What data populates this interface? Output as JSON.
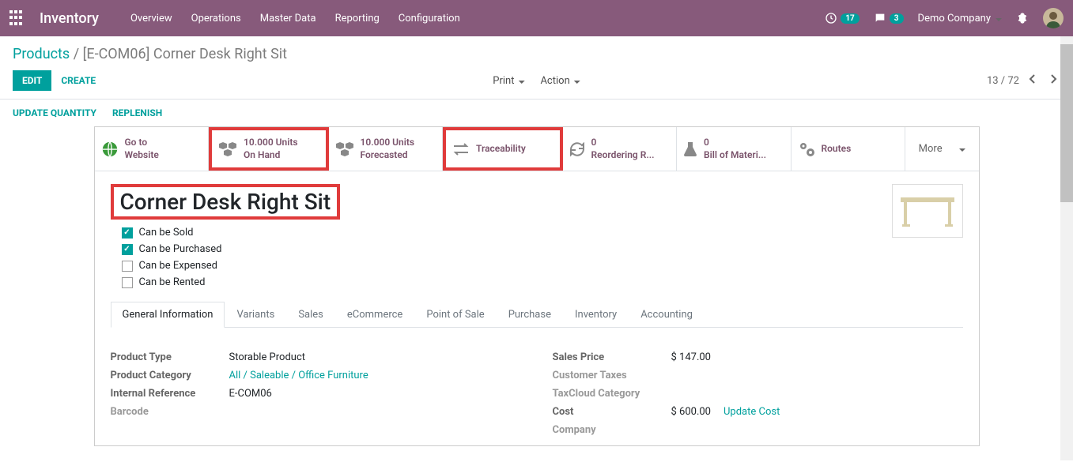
{
  "topbar": {
    "app_name": "Inventory",
    "nav": [
      "Overview",
      "Operations",
      "Master Data",
      "Reporting",
      "Configuration"
    ],
    "clock_badge": "17",
    "chat_badge": "3",
    "company": "Demo Company"
  },
  "breadcrumb": {
    "root": "Products",
    "current": "[E-COM06] Corner Desk Right Sit"
  },
  "buttons": {
    "edit": "EDIT",
    "create": "CREATE",
    "print": "Print",
    "action": "Action"
  },
  "pager": {
    "pos": "13 / 72"
  },
  "secondary": {
    "update_qty": "UPDATE QUANTITY",
    "replenish": "REPLENISH"
  },
  "stats": {
    "go_website": {
      "l1": "Go to",
      "l2": "Website"
    },
    "on_hand": {
      "l1": "10.000 Units",
      "l2": "On Hand"
    },
    "forecast": {
      "l1": "10.000 Units",
      "l2": "Forecasted"
    },
    "trace": {
      "l1": "Traceability"
    },
    "reorder": {
      "l1": "0",
      "l2": "Reordering R..."
    },
    "bom": {
      "l1": "0",
      "l2": "Bill of Materi..."
    },
    "routes": {
      "l1": "Routes"
    },
    "more": "More"
  },
  "product": {
    "title": "Corner Desk Right Sit",
    "can_be_sold": "Can be Sold",
    "can_be_purchased": "Can be Purchased",
    "can_be_expensed": "Can be Expensed",
    "can_be_rented": "Can be Rented"
  },
  "tabs": [
    "General Information",
    "Variants",
    "Sales",
    "eCommerce",
    "Point of Sale",
    "Purchase",
    "Inventory",
    "Accounting"
  ],
  "fields": {
    "left": {
      "product_type_label": "Product Type",
      "product_type": "Storable Product",
      "category_label": "Product Category",
      "category": "All / Saleable / Office Furniture",
      "internal_ref_label": "Internal Reference",
      "internal_ref": "E-COM06",
      "barcode_label": "Barcode",
      "barcode": ""
    },
    "right": {
      "sales_price_label": "Sales Price",
      "sales_price": "$ 147.00",
      "customer_taxes_label": "Customer Taxes",
      "taxcloud_label": "TaxCloud Category",
      "cost_label": "Cost",
      "cost": "$ 600.00",
      "update_cost": "Update Cost",
      "company_label": "Company"
    }
  }
}
